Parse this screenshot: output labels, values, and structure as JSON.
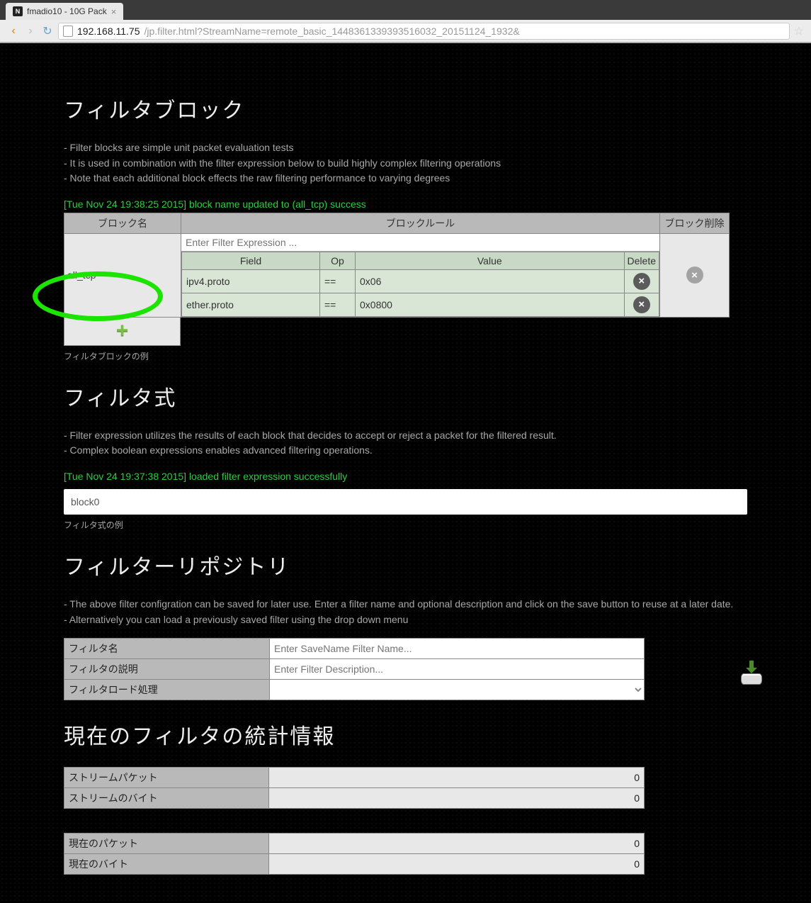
{
  "browser": {
    "tab_title": "fmadio10 - 10G Pack",
    "url_host": "192.168.11.75",
    "url_path": "/jp.filter.html?StreamName=remote_basic_1448361339393516032_20151124_1932&"
  },
  "filter_block": {
    "title": "フィルタブロック",
    "desc": [
      "- Filter blocks are simple unit packet evaluation tests",
      "- It is used in combination with the filter expression below to build highly complex filtering operations",
      "- Note that each additional block effects the raw filtering performance to varying degrees"
    ],
    "status": "[Tue Nov 24 19:38:25 2015] block name updated to (all_tcp) success",
    "headers": {
      "name": "ブロック名",
      "rule": "ブロックルール",
      "delete": "ブロック削除"
    },
    "block_name": "all_tcp",
    "expr_placeholder": "Enter Filter Expression ...",
    "rule_headers": {
      "field": "Field",
      "op": "Op",
      "value": "Value",
      "delete": "Delete"
    },
    "rules": [
      {
        "field": "ipv4.proto",
        "op": "==",
        "value": "0x06"
      },
      {
        "field": "ether.proto",
        "op": "==",
        "value": "0x0800"
      }
    ],
    "caption": "フィルタブロックの例"
  },
  "filter_expr": {
    "title": "フィルタ式",
    "desc": [
      "- Filter expression utilizes the results of each block that decides to accept or reject a packet for the filtered result.",
      "- Complex boolean expressions enables advanced filtering operations."
    ],
    "status": "[Tue Nov 24 19:37:38 2015] loaded filter expression successfully",
    "value": "block0",
    "caption": "フィルタ式の例"
  },
  "repo": {
    "title": "フィルターリポジトリ",
    "desc": [
      "- The above filter configration can be saved for later use. Enter a filter name and optional description and click on the save button to reuse at a later date.",
      "- Alternatively you can load a previously saved filter using the drop down menu"
    ],
    "rows": {
      "name_label": "フィルタ名",
      "name_placeholder": "Enter SaveName Filter Name...",
      "desc_label": "フィルタの説明",
      "desc_placeholder": "Enter Filter Description...",
      "load_label": "フィルタロード処理"
    }
  },
  "stats": {
    "title": "現在のフィルタの統計情報",
    "rows1": [
      {
        "label": "ストリームパケット",
        "value": "0"
      },
      {
        "label": "ストリームのバイト",
        "value": "0"
      }
    ],
    "rows2": [
      {
        "label": "現在のパケット",
        "value": "0"
      },
      {
        "label": "現在のバイト",
        "value": "0"
      }
    ]
  }
}
